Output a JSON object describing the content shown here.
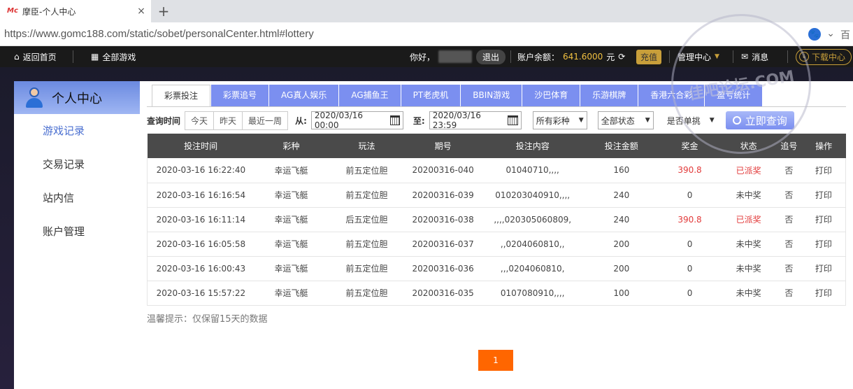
{
  "browser": {
    "tab_title": "摩臣-个人中心",
    "favicon_text": "Mc",
    "close": "×",
    "newtab": "+",
    "url": "https://www.gomc188.com/static/sobet/personalCenter.html#lottery",
    "right_text": "百"
  },
  "topnav": {
    "home": "返回首页",
    "all_games": "全部游戏",
    "greeting": "你好，",
    "logout": "退出",
    "balance_label": "账户余额：",
    "balance_value": "641.6000",
    "balance_unit": "元",
    "recharge": "充值",
    "manage": "管理中心",
    "messages": "消息",
    "download": "下载中心"
  },
  "sidebar": {
    "title": "个人中心",
    "items": [
      {
        "label": "游戏记录"
      },
      {
        "label": "交易记录"
      },
      {
        "label": "站内信"
      },
      {
        "label": "账户管理"
      }
    ]
  },
  "tabs": [
    {
      "label": "彩票投注"
    },
    {
      "label": "彩票追号"
    },
    {
      "label": "AG真人娱乐"
    },
    {
      "label": "AG捕鱼王"
    },
    {
      "label": "PT老虎机"
    },
    {
      "label": "BBIN游戏"
    },
    {
      "label": "沙巴体育"
    },
    {
      "label": "乐游棋牌"
    },
    {
      "label": "香港六合彩"
    },
    {
      "label": "盈亏统计"
    }
  ],
  "filter": {
    "label": "查询时间",
    "quick": [
      "今天",
      "昨天",
      "最近一周"
    ],
    "from_label": "从:",
    "from_value": "2020/03/16 00:00",
    "to_label": "至:",
    "to_value": "2020/03/16 23:59",
    "lottery_select": "所有彩种",
    "status_select": "全部状态",
    "single_select": "是否单挑",
    "query_button": "立即查询"
  },
  "table": {
    "headers": [
      "投注时间",
      "彩种",
      "玩法",
      "期号",
      "投注内容",
      "投注金额",
      "奖金",
      "状态",
      "追号",
      "操作"
    ],
    "rows": [
      [
        "2020-03-16 16:22:40",
        "幸运飞艇",
        "前五定位胆",
        "20200316-040",
        "01040710,,,,",
        "160",
        "390.8",
        "已派奖",
        "否",
        "打印"
      ],
      [
        "2020-03-16 16:16:54",
        "幸运飞艇",
        "前五定位胆",
        "20200316-039",
        "010203040910,,,,",
        "240",
        "0",
        "未中奖",
        "否",
        "打印"
      ],
      [
        "2020-03-16 16:11:14",
        "幸运飞艇",
        "后五定位胆",
        "20200316-038",
        ",,,,020305060809,",
        "240",
        "390.8",
        "已派奖",
        "否",
        "打印"
      ],
      [
        "2020-03-16 16:05:58",
        "幸运飞艇",
        "前五定位胆",
        "20200316-037",
        ",,0204060810,,",
        "200",
        "0",
        "未中奖",
        "否",
        "打印"
      ],
      [
        "2020-03-16 16:00:43",
        "幸运飞艇",
        "前五定位胆",
        "20200316-036",
        ",,,0204060810,",
        "200",
        "0",
        "未中奖",
        "否",
        "打印"
      ],
      [
        "2020-03-16 15:57:22",
        "幸运飞艇",
        "前五定位胆",
        "20200316-035",
        "0107080910,,,,",
        "100",
        "0",
        "未中奖",
        "否",
        "打印"
      ]
    ]
  },
  "tip": "温馨提示：仅保留15天的数据",
  "pager": {
    "current": "1"
  },
  "watermark": "佳吧论坛.COM",
  "colors": {
    "accent": "#7b8ff0",
    "won": "#e23a3a",
    "pager": "#ff6600",
    "gold": "#f0c040"
  }
}
